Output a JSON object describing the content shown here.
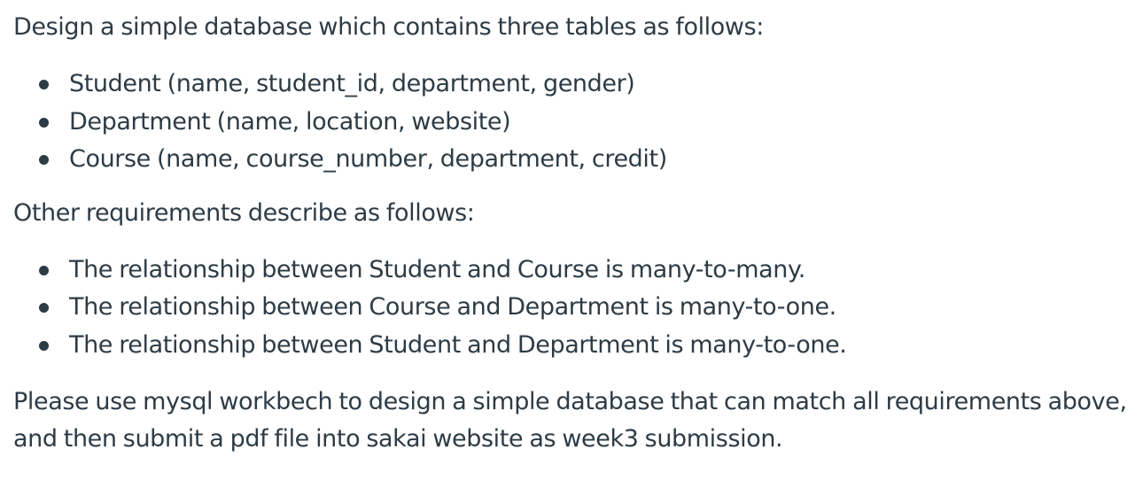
{
  "document": {
    "intro": "Design a simple database which contains three tables as follows:",
    "tables": [
      "Student  (name, student_id, department, gender)",
      "Department (name, location, website)",
      "Course (name, course_number, department, credit)"
    ],
    "requirements_intro": "Other requirements describe as follows:",
    "requirements": [
      "The relationship between Student and Course is many-to-many.",
      "The relationship between Course and Department is many-to-one.",
      "The relationship between Student and Department is many-to-one."
    ],
    "closing_line_1": "Please use mysql workbech to design a simple database that can match all requirements above,",
    "closing_line_2": "and then submit a pdf file into sakai website as week3 submission."
  }
}
